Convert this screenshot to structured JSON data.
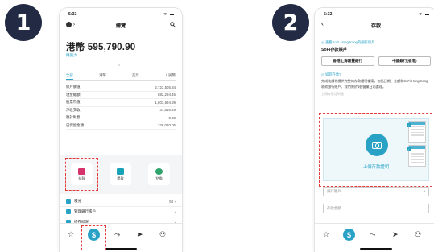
{
  "steps": [
    "1",
    "2"
  ],
  "colors": {
    "accent": "#29a2c6",
    "highlight": "#e23b3b",
    "step_badge": "#232b44"
  },
  "screen1": {
    "status": {
      "time": "5:32",
      "icons": "··· ᯤ ▬"
    },
    "nav": {
      "title": "總覽",
      "left_icon": "avatar",
      "right_icon": "search-icon",
      "left_chevron": "›"
    },
    "balance": "港幣 595,790.90",
    "purchasing_power": "購買力",
    "caret": "⌃",
    "tabs": [
      "全部",
      "港幣",
      "美元",
      "人民幣"
    ],
    "rows": [
      {
        "label": "賬戶價值",
        "value": "2,723,505.84"
      },
      {
        "label": "現金總額",
        "value": "882,294.46"
      },
      {
        "label": "股票市值",
        "value": "1,803,694.89"
      },
      {
        "label": "淨收交收",
        "value": "37,516.49"
      },
      {
        "label": "應計利息",
        "value": "0.00"
      },
      {
        "label": "已保留金額",
        "value": "328,020.05"
      }
    ],
    "actions": [
      {
        "label": "存款",
        "icon": "deposit-icon",
        "color": "#d6336c"
      },
      {
        "label": "提款",
        "icon": "withdraw-icon",
        "color": "#17a2b8"
      },
      {
        "label": "兌換",
        "icon": "exchange-icon",
        "color": "#2fa36b"
      }
    ],
    "menu": [
      {
        "label": "積分",
        "value": "50 ›",
        "icon": "points-icon",
        "color": "#29a2c6"
      },
      {
        "label": "管理銀行賬戶",
        "value": "›",
        "icon": "bank-card-icon",
        "color": "#29a2c6"
      },
      {
        "label": "提存狀況",
        "value": "›",
        "icon": "status-icon",
        "color": "#29a2c6"
      }
    ],
    "tabbar": {
      "star": "☆",
      "dollar": "$",
      "chart": "⤳",
      "send": "➤",
      "people": "⚇"
    }
  },
  "screen2": {
    "status": {
      "time": "5:32",
      "icons": "··· ᯤ ▬"
    },
    "nav": {
      "title": "存款",
      "back": "‹"
    },
    "link1": "◎ 查看SoFi Hong Kong的銀行賬戶",
    "account_title": "SoFi存款賬戶",
    "banks": [
      "香港上海匯豐銀行",
      "中國銀行(香港)"
    ],
    "link2": "◎ 如何存款?",
    "instructions": "完成後請你提供完整的存款證明檔案，包括日期、金額和SoFi Hong Kong收款銀行賬戶。我們將於1個營業日內處理。",
    "faded": "上傳存款證明後",
    "upload_label": "上傳存款證明",
    "fields": [
      {
        "placeholder": "銀行賬戶",
        "suffix": "▾"
      },
      {
        "placeholder": "存款金額",
        "suffix": ""
      }
    ],
    "tabbar": {
      "star": "☆",
      "dollar": "$",
      "chart": "⤳",
      "send": "➤",
      "people": "⚇"
    }
  }
}
